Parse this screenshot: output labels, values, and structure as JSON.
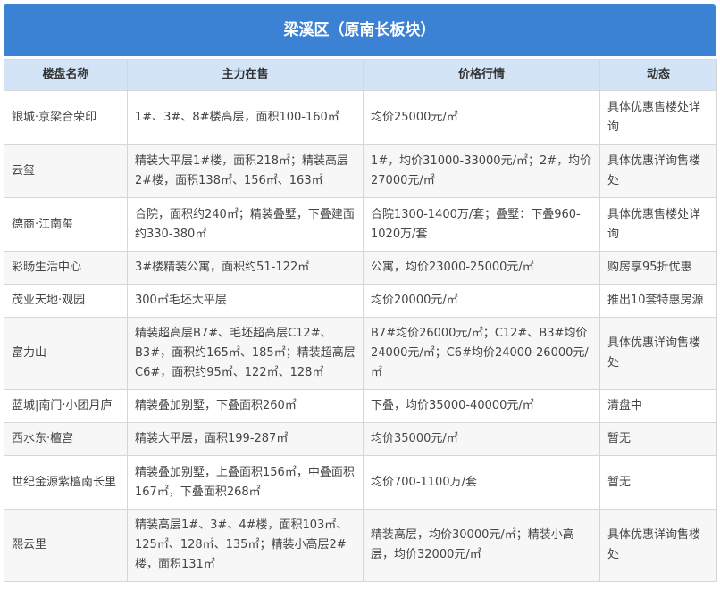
{
  "title": "梁溪区（原南长板块）",
  "headers": [
    "楼盘名称",
    "主力在售",
    "价格行情",
    "动态"
  ],
  "rows": [
    [
      "银城·京梁合荣印",
      "1#、3#、8#楼高层，面积100-160㎡",
      "均价25000元/㎡",
      "具体优惠售楼处详询"
    ],
    [
      "云玺",
      "精装大平层1#楼，面积218㎡；精装高层2#楼，面积138㎡、156㎡、163㎡",
      "1#，均价31000-33000元/㎡；2#，均价27000元/㎡",
      "具体优惠详询售楼处"
    ],
    [
      "德商·江南玺",
      "合院，面积约240㎡；精装叠墅，下叠建面约330-380㎡",
      "合院1300-1400万/套；叠墅：下叠960-1020万/套",
      "具体优惠售楼处详询"
    ],
    [
      "彩旸生活中心",
      "3#楼精装公寓，面积约51-122㎡",
      "公寓，均价23000-25000元/㎡",
      "购房享95折优惠"
    ],
    [
      "茂业天地·观园",
      "300㎡毛坯大平层",
      "均价20000元/㎡",
      "推出10套特惠房源"
    ],
    [
      "富力山",
      "精装超高层B7#、毛坯超高层C12#、B3#，面积约165㎡、185㎡；精装超高层C6#，面积约95㎡、122㎡、128㎡",
      "B7#均价26000元/㎡；C12#、B3#均价24000元/㎡；C6#均价24000-26000元/㎡",
      "具体优惠详询售楼处"
    ],
    [
      "蓝城|南门·小团月庐",
      "精装叠加别墅，下叠面积260㎡",
      "下叠，均价35000-40000元/㎡",
      "清盘中"
    ],
    [
      "西水东·檀宫",
      "精装大平层，面积199-287㎡",
      "均价35000元/㎡",
      "暂无"
    ],
    [
      "世纪金源紫檀南长里",
      "精装叠加别墅，上叠面积156㎡，中叠面积167㎡，下叠面积268㎡",
      "均价700-1100万/套",
      "暂无"
    ],
    [
      "熙云里",
      "精装高层1#、3#、4#楼，面积103㎡、125㎡、128㎡、135㎡；精装小高层2#楼，面积131㎡",
      "精装高层，均价30000元/㎡；精装小高层，均价32000元/㎡",
      "具体优惠详询售楼处"
    ]
  ]
}
